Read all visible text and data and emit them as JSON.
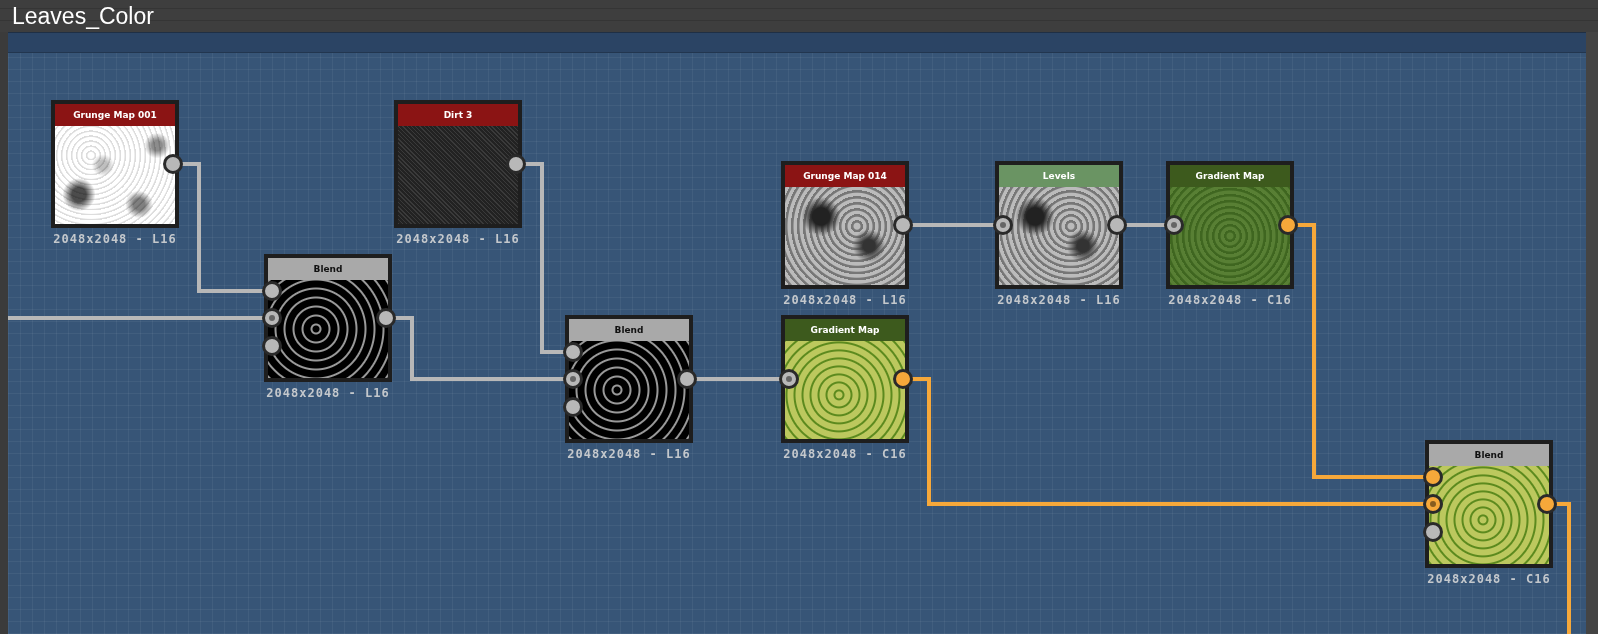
{
  "window": {
    "title": "Leaves_Color"
  },
  "nodes": [
    {
      "title": "Grunge Map 001",
      "color": "#8b1414",
      "kind": "light-grunge",
      "resolution": "2048x2048 - L16",
      "output": {
        "color": "#b8b8b8"
      }
    },
    {
      "title": "Dirt 3",
      "color": "#8b1414",
      "kind": "noise",
      "resolution": "2048x2048 - L16",
      "output": {
        "color": "#b8b8b8"
      }
    },
    {
      "title": "Blend",
      "color": "#a9a9a9",
      "kind": "mask",
      "resolution": "2048x2048 - L16",
      "inputs": [
        {
          "kind": "plain",
          "color": "#b8b8b8"
        },
        {
          "kind": "mask",
          "color": "#b8b8b8"
        },
        {
          "kind": "plain",
          "color": "#b8b8b8"
        }
      ],
      "output": {
        "color": "#b8b8b8"
      }
    },
    {
      "title": "Blend",
      "color": "#a9a9a9",
      "kind": "mask",
      "resolution": "2048x2048 - L16",
      "inputs": [
        {
          "kind": "plain",
          "color": "#b8b8b8"
        },
        {
          "kind": "mask",
          "color": "#b8b8b8"
        },
        {
          "kind": "plain",
          "color": "#b8b8b8"
        }
      ],
      "output": {
        "color": "#b8b8b8"
      }
    },
    {
      "title": "Grunge Map 014",
      "color": "#8b1414",
      "kind": "grey-grunge",
      "resolution": "2048x2048 - L16",
      "output": {
        "color": "#b8b8b8"
      }
    },
    {
      "title": "Levels",
      "color": "#6a9463",
      "kind": "grey-grunge",
      "resolution": "2048x2048 - L16",
      "inputs": [
        {
          "kind": "mask",
          "color": "#b8b8b8"
        }
      ],
      "output": {
        "color": "#b8b8b8"
      }
    },
    {
      "title": "Gradient Map",
      "color": "#3d5a1d",
      "kind": "dark-green",
      "resolution": "2048x2048 - C16",
      "inputs": [
        {
          "kind": "mask",
          "color": "#b8b8b8"
        }
      ],
      "output": {
        "color": "#f6a83a"
      }
    },
    {
      "title": "Gradient Map",
      "color": "#3d5a1d",
      "kind": "light-green",
      "resolution": "2048x2048 - C16",
      "inputs": [
        {
          "kind": "mask",
          "color": "#b8b8b8"
        }
      ],
      "output": {
        "color": "#f6a83a"
      }
    },
    {
      "title": "Blend",
      "color": "#a9a9a9",
      "kind": "light-green",
      "resolution": "2048x2048 - C16",
      "inputs": [
        {
          "kind": "plain",
          "color": "#f6a83a"
        },
        {
          "kind": "mask",
          "color": "#f6a83a"
        },
        {
          "kind": "plain",
          "color": "#b8b8b8"
        }
      ],
      "output": {
        "color": "#f6a83a"
      }
    }
  ]
}
